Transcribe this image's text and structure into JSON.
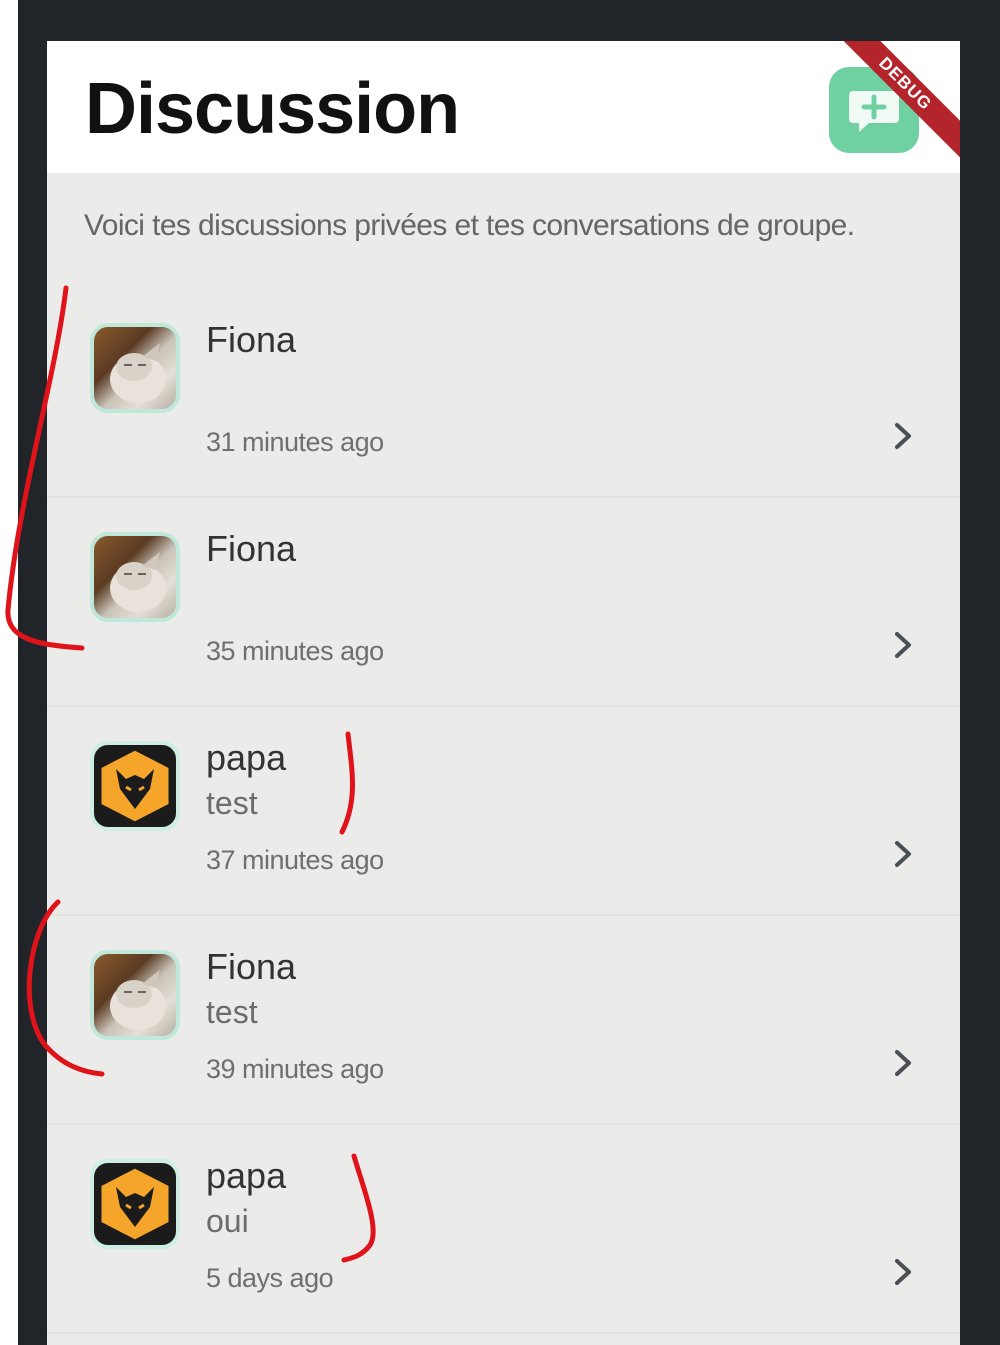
{
  "header": {
    "title": "Discussion",
    "new_chat_icon": "chat-plus-icon",
    "debug_label": "DEBUG"
  },
  "subtitle": "Voici tes discussions privées et tes conversations de groupe.",
  "colors": {
    "accent": "#6fd1a2",
    "debug_banner": "#b3242b",
    "frame": "#21252a",
    "list_bg": "#ebebea",
    "annotation": "#e0131b"
  },
  "conversations": [
    {
      "name": "Fiona",
      "message": "",
      "time": "31 minutes ago",
      "avatar": "cat-photo"
    },
    {
      "name": "Fiona",
      "message": "",
      "time": "35 minutes ago",
      "avatar": "cat-photo"
    },
    {
      "name": "papa",
      "message": "test",
      "time": "37 minutes ago",
      "avatar": "wolf-logo"
    },
    {
      "name": "Fiona",
      "message": "test",
      "time": "39 minutes ago",
      "avatar": "cat-photo"
    },
    {
      "name": "papa",
      "message": "oui",
      "time": "5 days ago",
      "avatar": "wolf-logo"
    }
  ]
}
